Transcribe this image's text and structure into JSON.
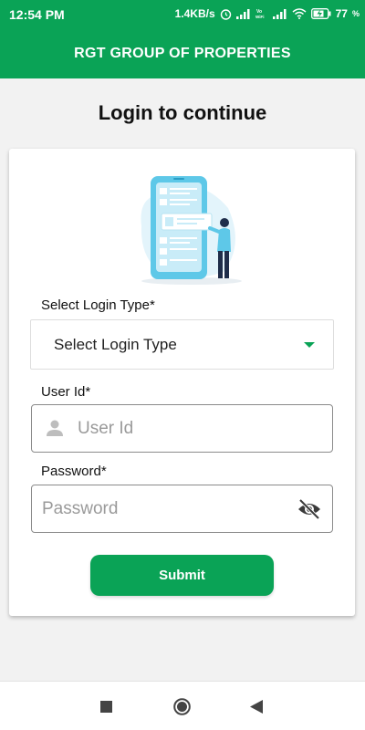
{
  "status_bar": {
    "time": "12:54 PM",
    "speed": "1.4KB/s",
    "volte": "Vo\nWiFi",
    "battery": "77",
    "icons": [
      "alarm-icon",
      "signal-icon",
      "vowifi-icon",
      "signal-icon",
      "wifi-icon",
      "battery-charging-icon"
    ]
  },
  "app_bar": {
    "title": "RGT GROUP OF PROPERTIES"
  },
  "page": {
    "heading": "Login to continue"
  },
  "form": {
    "login_type_label": "Select Login Type*",
    "login_type_value": "Select Login Type",
    "user_id_label": "User Id*",
    "user_id_placeholder": "User Id",
    "password_label": "Password*",
    "password_placeholder": "Password",
    "submit_label": "Submit"
  },
  "nav_bar": {
    "buttons": [
      "recents-square-icon",
      "home-circle-icon",
      "back-triangle-icon"
    ]
  },
  "colors": {
    "primary": "#0aa356",
    "background": "#f2f2f2",
    "card": "#ffffff"
  }
}
